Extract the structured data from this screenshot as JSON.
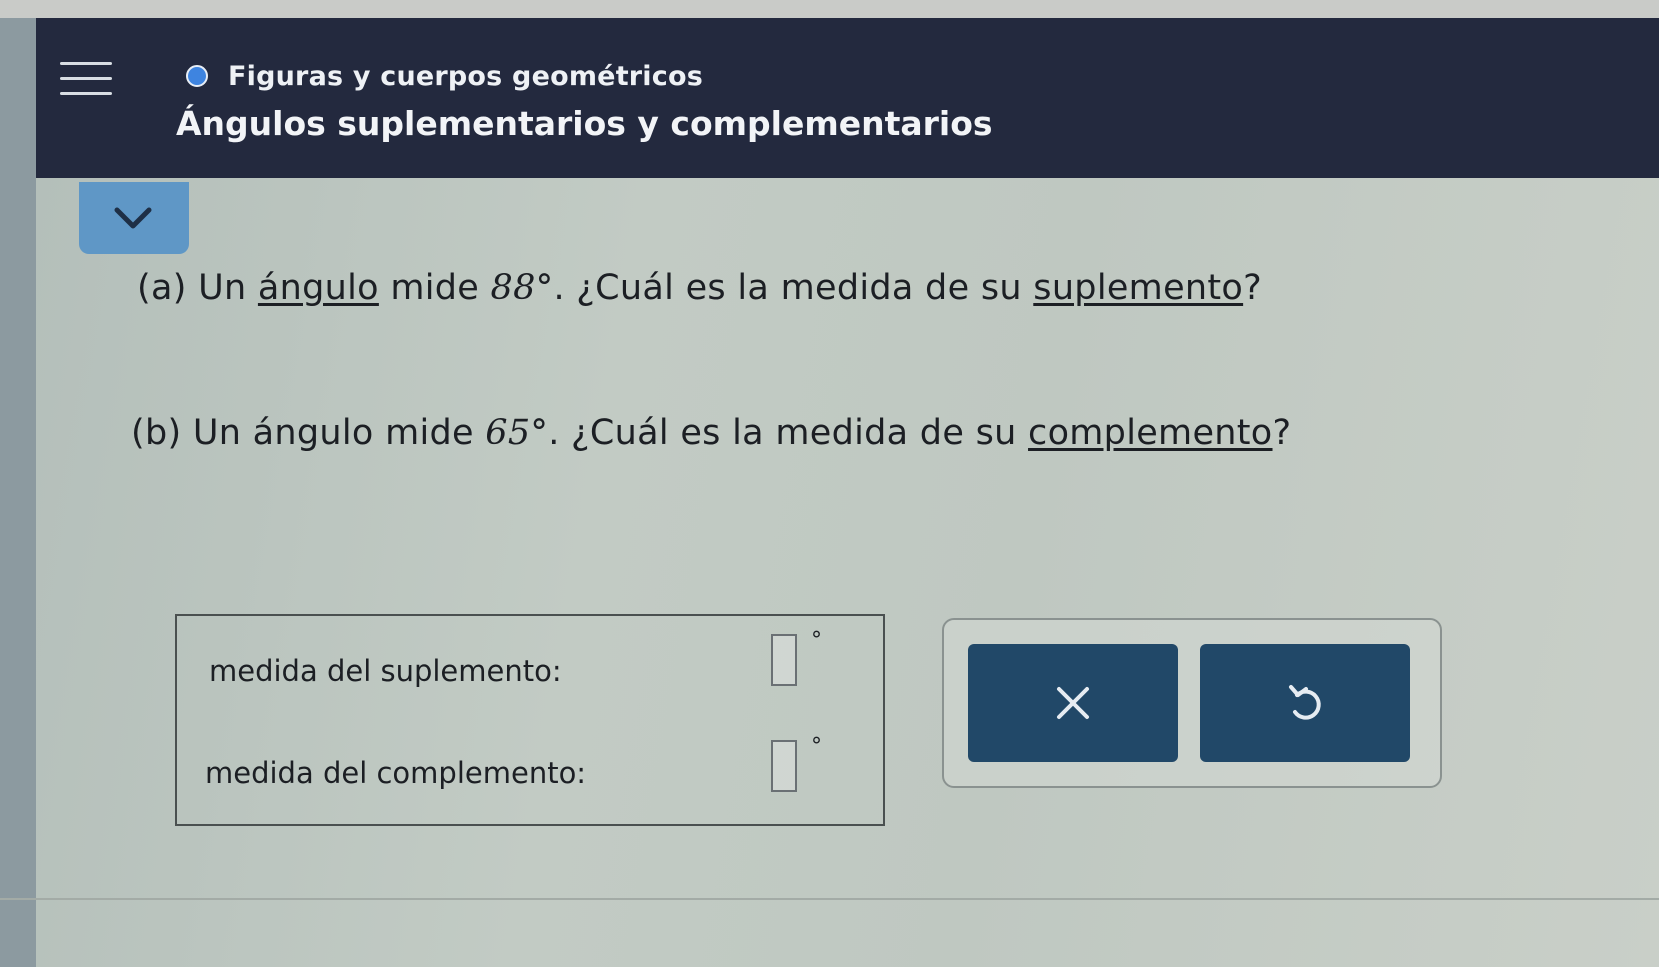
{
  "header": {
    "topic": "Figuras y cuerpos geométricos",
    "lesson_title": "Ángulos suplementarios y complementarios",
    "accent_color": "#3e84e0",
    "menu_icon": "hamburger-menu-icon"
  },
  "collapse_icon": "chevron-down-icon",
  "questions": {
    "a": {
      "prefix": "(a) Un ",
      "link1": "ángulo",
      "mid": " mide ",
      "value": "88°",
      "suffix": ". ¿Cuál es la medida de su ",
      "link2": "suplemento",
      "end": "?"
    },
    "b": {
      "prefix": "(b) Un ángulo mide ",
      "value": "65°",
      "suffix": ". ¿Cuál es la medida de su ",
      "link2": "complemento",
      "end": "?"
    }
  },
  "answers": {
    "suplemento_label": "medida del suplemento:",
    "suplemento_value": "",
    "complemento_label": "medida del complemento:",
    "complemento_value": "",
    "degree_symbol": "°"
  },
  "buttons": {
    "clear_icon": "x-icon",
    "undo_icon": "undo-icon",
    "color": "#214868"
  }
}
